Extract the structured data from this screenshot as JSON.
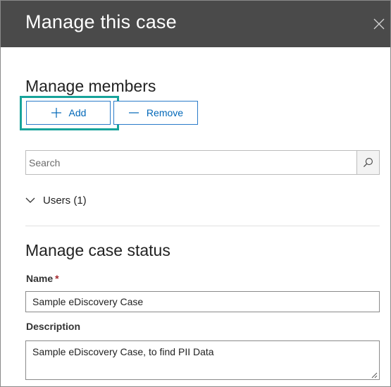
{
  "header": {
    "title": "Manage this case",
    "close_icon": "close-icon"
  },
  "members": {
    "title": "Manage members",
    "add_label": "Add",
    "add_icon": "plus-icon",
    "remove_label": "Remove",
    "remove_icon": "minus-icon",
    "search_placeholder": "Search",
    "search_icon": "search-icon",
    "users_label": "Users (1)",
    "users_icon": "chevron-down-icon"
  },
  "status": {
    "title": "Manage case status",
    "name_label": "Name",
    "required_marker": "*",
    "name_value": "Sample eDiscovery Case",
    "description_label": "Description",
    "description_value": "Sample eDiscovery Case, to find PII Data"
  },
  "colors": {
    "header_bg": "#4a4a4a",
    "accent": "#0067b8",
    "highlight": "#17a39b",
    "required": "#a4262c"
  }
}
